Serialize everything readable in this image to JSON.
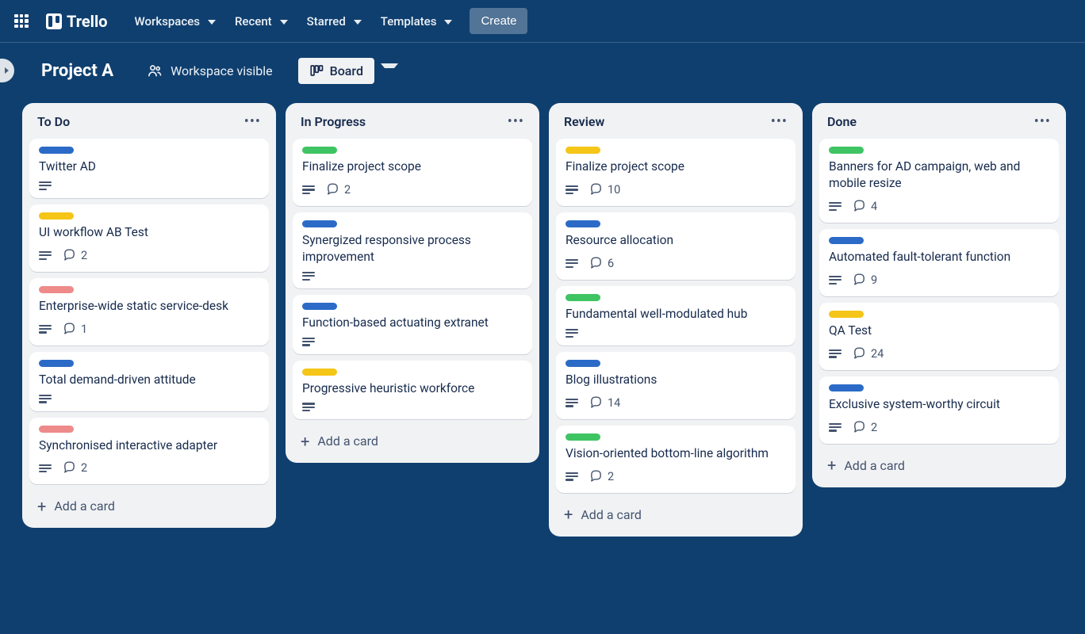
{
  "nav": {
    "logo_text": "Trello",
    "menus": [
      "Workspaces",
      "Recent",
      "Starred",
      "Templates"
    ],
    "create_label": "Create"
  },
  "board": {
    "title": "Project A",
    "visibility_label": "Workspace visible",
    "view_label": "Board"
  },
  "label_colors": {
    "blue": "#2b6bc7",
    "yellow": "#f5c518",
    "green": "#3fc463",
    "red": "#ee8a8a"
  },
  "add_card_label": "Add a card",
  "lists": [
    {
      "title": "To Do",
      "cards": [
        {
          "label": "blue",
          "title": "Twitter AD",
          "has_desc": true,
          "comments": null
        },
        {
          "label": "yellow",
          "title": "UI workflow AB Test",
          "has_desc": true,
          "comments": 2
        },
        {
          "label": "red",
          "title": "Enterprise-wide static service-desk",
          "has_desc": true,
          "comments": 1
        },
        {
          "label": "blue",
          "title": "Total demand-driven attitude",
          "has_desc": true,
          "comments": null
        },
        {
          "label": "red",
          "title": "Synchronised interactive adapter",
          "has_desc": true,
          "comments": 2
        }
      ]
    },
    {
      "title": "In Progress",
      "cards": [
        {
          "label": "green",
          "title": "Finalize project scope",
          "has_desc": true,
          "comments": 2
        },
        {
          "label": "blue",
          "title": "Synergized responsive process improvement",
          "has_desc": true,
          "comments": null
        },
        {
          "label": "blue",
          "title": "Function-based actuating extranet",
          "has_desc": true,
          "comments": null
        },
        {
          "label": "yellow",
          "title": "Progressive heuristic workforce",
          "has_desc": true,
          "comments": null
        }
      ]
    },
    {
      "title": "Review",
      "cards": [
        {
          "label": "yellow",
          "title": "Finalize project scope",
          "has_desc": true,
          "comments": 10
        },
        {
          "label": "blue",
          "title": "Resource allocation",
          "has_desc": true,
          "comments": 6
        },
        {
          "label": "green",
          "title": "Fundamental well-modulated hub",
          "has_desc": true,
          "comments": null
        },
        {
          "label": "blue",
          "title": "Blog illustrations",
          "has_desc": true,
          "comments": 14
        },
        {
          "label": "green",
          "title": "Vision-oriented bottom-line algorithm",
          "has_desc": true,
          "comments": 2
        }
      ]
    },
    {
      "title": "Done",
      "cards": [
        {
          "label": "green",
          "title": "Banners for AD campaign, web and mobile resize",
          "has_desc": true,
          "comments": 4
        },
        {
          "label": "blue",
          "title": "Automated fault-tolerant function",
          "has_desc": true,
          "comments": 9
        },
        {
          "label": "yellow",
          "title": "QA Test",
          "has_desc": true,
          "comments": 24
        },
        {
          "label": "blue",
          "title": "Exclusive system-worthy circuit",
          "has_desc": true,
          "comments": 2
        }
      ]
    }
  ]
}
